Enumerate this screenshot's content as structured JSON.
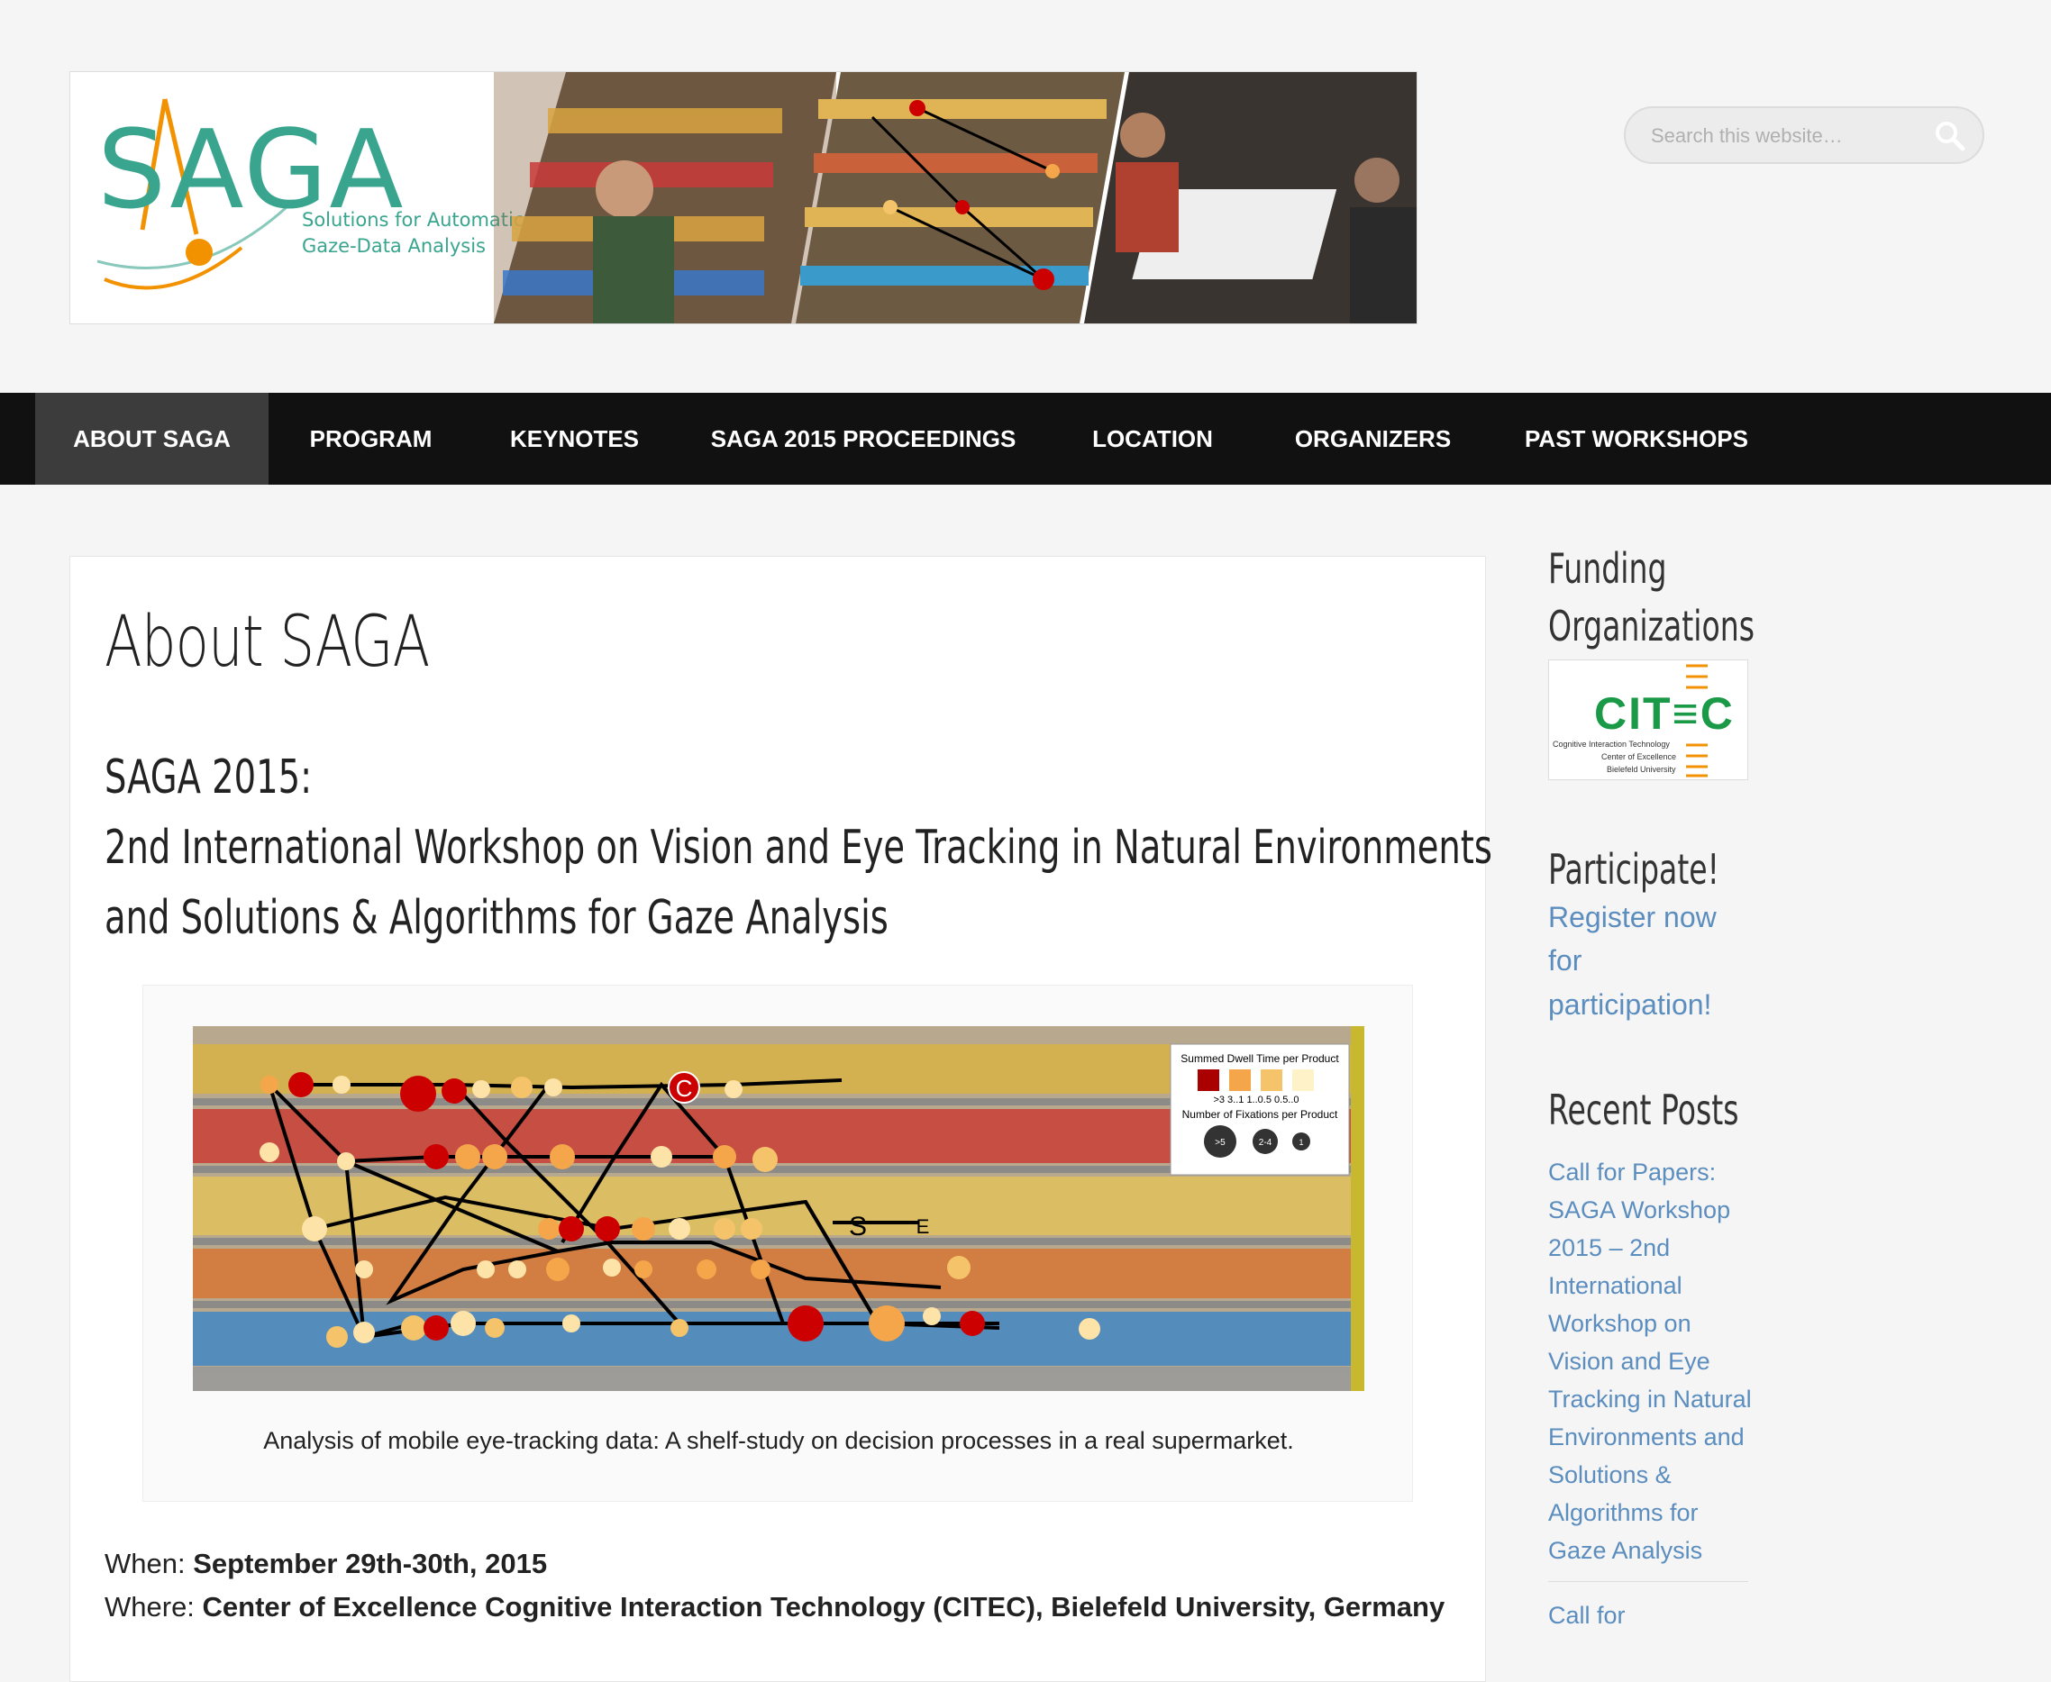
{
  "header": {
    "logo_word": "SAGA",
    "logo_subtitle_line1": "Solutions for Automatic",
    "logo_subtitle_line2": "Gaze-Data Analysis",
    "search_placeholder": "Search this website…"
  },
  "nav": {
    "items": [
      {
        "label": "ABOUT SAGA",
        "active": true
      },
      {
        "label": "PROGRAM"
      },
      {
        "label": "KEYNOTES"
      },
      {
        "label": "SAGA 2015 PROCEEDINGS"
      },
      {
        "label": "LOCATION"
      },
      {
        "label": "ORGANIZERS"
      },
      {
        "label": "PAST WORKSHOPS"
      }
    ]
  },
  "main": {
    "title": "About SAGA",
    "subtitle_line1": "SAGA 2015:",
    "subtitle_line2": "2nd International Workshop on Vision and Eye Tracking in Natural Environments",
    "subtitle_line3": "and Solutions & Algorithms for Gaze Analysis",
    "figure": {
      "legend_title": "Summed Dwell Time per Product",
      "legend_values": ">3   3..1  1..0.5 0.5..0",
      "legend_fixations": "Number of Fixations per Product",
      "legend_counts": [
        ">5",
        "2-4",
        "1"
      ],
      "marker_c": "C",
      "marker_s": "S",
      "marker_e": "E",
      "caption": "Analysis of mobile eye-tracking data: A shelf-study on decision processes in a real supermarket."
    },
    "when_label": "When:",
    "when_value": "September 29th-30th, 2015",
    "where_label": "Where:",
    "where_value": "Center of Excellence Cognitive Interaction Technology (CITEC), Bielefeld University, Germany"
  },
  "sidebar": {
    "funding_title_line1": "Funding",
    "funding_title_line2": "Organizations",
    "citec_logo": "CIT≡C",
    "citec_line1": "Cognitive Interaction Technology",
    "citec_line2": "Center of Excellence",
    "citec_line3": "Bielefeld University",
    "participate_title": "Participate!",
    "participate_link": [
      "Register now",
      "for",
      "participation!"
    ],
    "recent_posts_title": "Recent Posts",
    "recent_post_1": [
      "Call for Papers:",
      "SAGA Workshop",
      "2015 – 2nd",
      "International",
      "Workshop on",
      "Vision and Eye",
      "Tracking in Natural",
      "Environments and",
      "Solutions &",
      "Algorithms for",
      "Gaze Analysis"
    ],
    "recent_post_2": [
      "Call for"
    ]
  },
  "colors": {
    "brand_teal": "#3aa58f",
    "brand_orange": "#f39200",
    "nav_bg": "#111111",
    "nav_active": "#3c3c3c",
    "link": "#5b8dbf",
    "citec_green": "#1a9946"
  }
}
